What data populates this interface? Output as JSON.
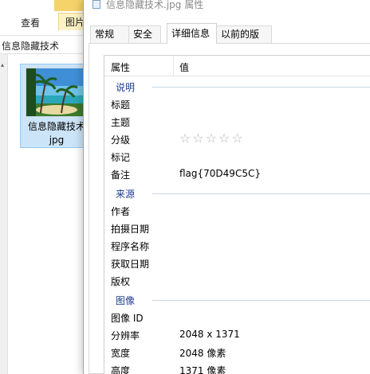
{
  "explorer": {
    "ribbon_tabs": [
      "查看",
      "图片"
    ],
    "address": "信息隐藏技术",
    "file": {
      "name_line1": "信息隐藏技术",
      "name_line2": "jpg"
    }
  },
  "dialog": {
    "title": "信息隐藏技术.jpg 属性",
    "tabs": [
      "常规",
      "安全",
      "详细信息",
      "以前的版本"
    ],
    "active_tab": "详细信息",
    "columns": {
      "name": "属性",
      "value": "值"
    },
    "groups": {
      "description": "说明",
      "origin": "来源",
      "image": "图像"
    },
    "description_rows": [
      {
        "k": "标题",
        "v": ""
      },
      {
        "k": "主题",
        "v": ""
      },
      {
        "k": "分级",
        "v": ""
      },
      {
        "k": "标记",
        "v": ""
      },
      {
        "k": "备注",
        "v": "flag{70D49C5C}"
      }
    ],
    "rating_stars": "☆☆☆☆☆",
    "rating_value": 0,
    "origin_rows": [
      {
        "k": "作者",
        "v": ""
      },
      {
        "k": "拍摄日期",
        "v": ""
      },
      {
        "k": "程序名称",
        "v": ""
      },
      {
        "k": "获取日期",
        "v": ""
      },
      {
        "k": "版权",
        "v": ""
      }
    ],
    "image_rows": [
      {
        "k": "图像 ID",
        "v": ""
      },
      {
        "k": "分辨率",
        "v": "2048 x 1371"
      },
      {
        "k": "宽度",
        "v": "2048 像素"
      },
      {
        "k": "高度",
        "v": "1371 像素"
      }
    ]
  }
}
